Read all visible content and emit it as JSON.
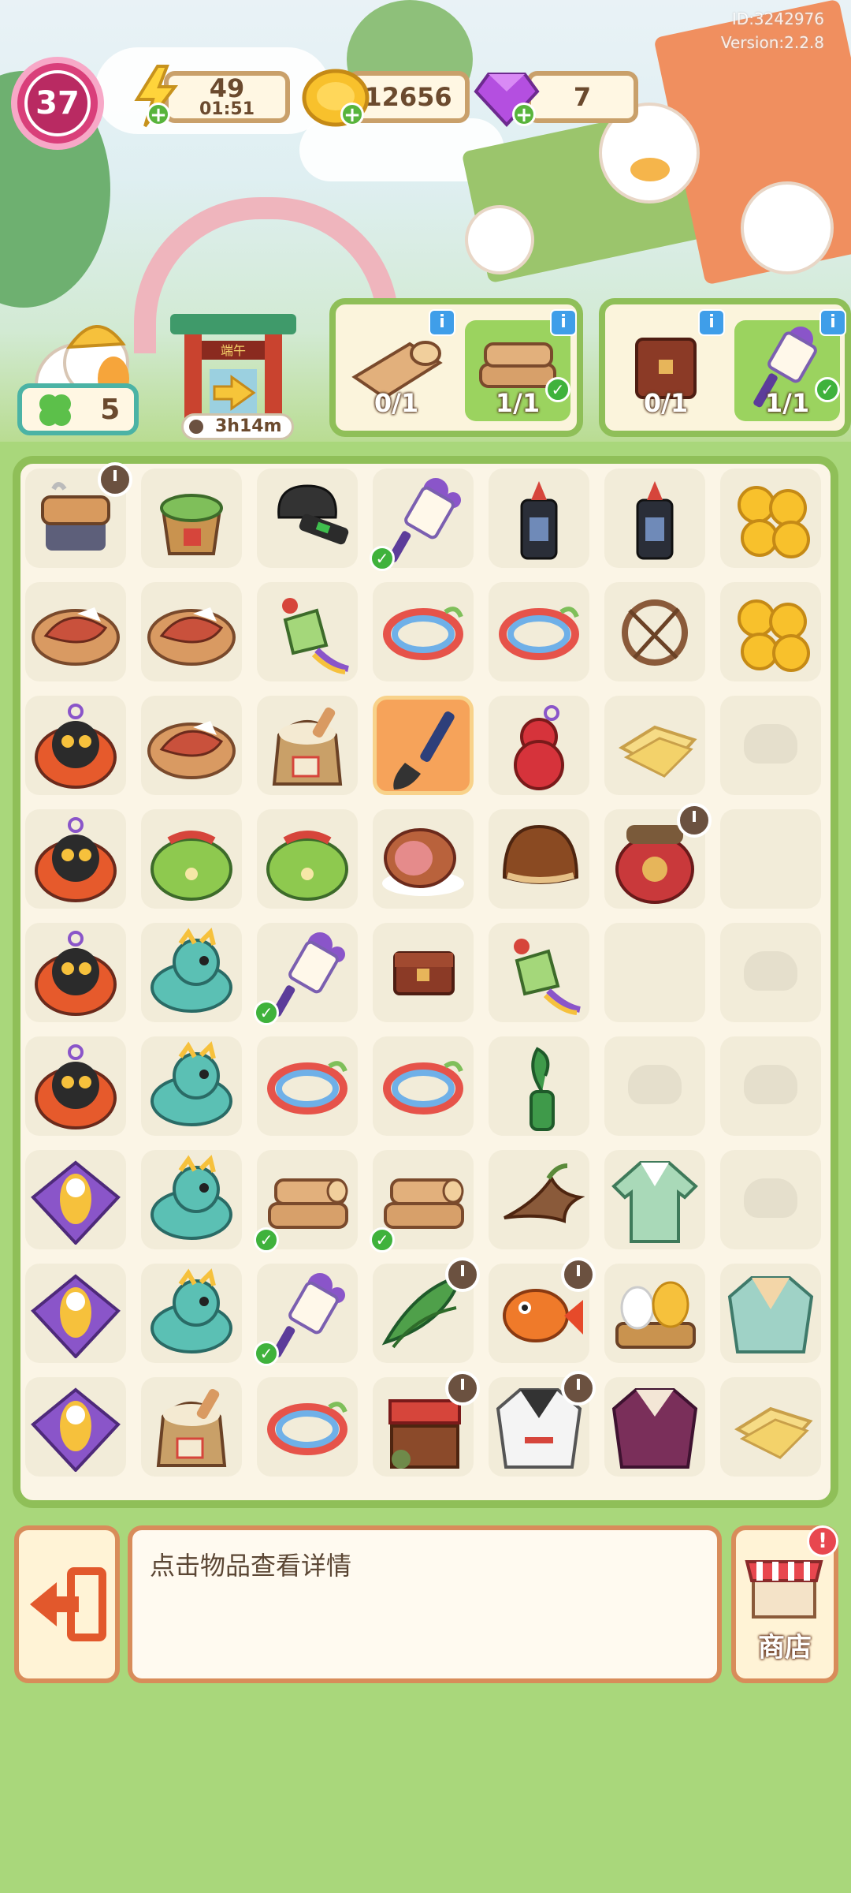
{
  "header": {
    "level": "37",
    "energy": {
      "value": "49",
      "timer": "01:51"
    },
    "coins": {
      "value": "12656"
    },
    "gems": {
      "value": "7"
    },
    "player_id": "ID:3242976",
    "version": "Version:2.2.8"
  },
  "helper": {
    "count": "5"
  },
  "gate": {
    "timer": "3h14m",
    "sign": "端午"
  },
  "orders": [
    {
      "items": [
        {
          "icon": "log-icon",
          "progress": "0/1",
          "done": false
        },
        {
          "icon": "woodpile-icon",
          "progress": "1/1",
          "done": true
        }
      ]
    },
    {
      "items": [
        {
          "icon": "wooden-chest-icon",
          "progress": "0/1",
          "done": false
        },
        {
          "icon": "scroll-icon",
          "progress": "1/1",
          "done": true
        }
      ]
    }
  ],
  "board": {
    "columns": 7,
    "rows": [
      [
        "steamer-stove-icon",
        "zongzi-bucket-icon",
        "inkstone-icon",
        "scroll-icon",
        "ink-bottle-icon",
        "ink-bottle-icon",
        "coin-pile-icon"
      ],
      [
        "ham-plate-icon",
        "ham-plate-icon",
        "zongzi-charm-icon",
        "rainbow-bracelet-icon",
        "rainbow-bracelet-icon",
        "twig-wreath-icon",
        "coin-pile-icon"
      ],
      [
        "tiger-sachet-icon",
        "ham-plate-icon",
        "rice-sack-icon",
        "brush-icon",
        "red-gourd-icon",
        "silk-fabric-icon",
        "locked"
      ],
      [
        "tiger-sachet-icon",
        "green-pouch-icon",
        "green-pouch-icon",
        "roast-ham-icon",
        "chestnut-icon",
        "wine-jar-icon",
        "empty"
      ],
      [
        "tiger-sachet-icon",
        "dragon-icon",
        "scroll-icon",
        "wooden-chest-icon",
        "zongzi-charm-icon",
        "empty",
        "locked"
      ],
      [
        "tiger-sachet-icon",
        "dragon-icon",
        "rainbow-bracelet-icon",
        "rainbow-bracelet-icon",
        "bamboo-sprout-icon",
        "locked",
        "locked"
      ],
      [
        "swallow-kite-icon",
        "dragon-icon",
        "woodpile-icon",
        "woodpile-icon",
        "tree-root-icon",
        "hanfu-green-icon",
        "locked"
      ],
      [
        "swallow-kite-icon",
        "dragon-icon",
        "scroll-icon",
        "bamboo-leaves-icon",
        "koi-fish-icon",
        "egg-basket-icon",
        "hanfu-robe-icon"
      ],
      [
        "swallow-kite-icon",
        "rice-sack-icon",
        "rainbow-bracelet-icon",
        "market-stall-icon",
        "white-robe-icon",
        "purple-robe-icon",
        "silk-fabric-icon"
      ]
    ],
    "selected_cell": "2-3",
    "checked_cells": [
      "0-3",
      "4-2",
      "6-2",
      "6-3",
      "7-2"
    ],
    "timer_cells": [
      "0-0",
      "3-5",
      "7-3",
      "7-4",
      "8-3",
      "8-4"
    ]
  },
  "info_panel": {
    "text": "点击物品查看详情"
  },
  "buttons": {
    "exit_icon": "exit-door-icon",
    "shop_label": "商店",
    "shop_alert": "!"
  },
  "colors": {
    "board_border": "#8fbf58",
    "panel_border": "#d88c5a",
    "level_badge": "#d93f7a"
  }
}
